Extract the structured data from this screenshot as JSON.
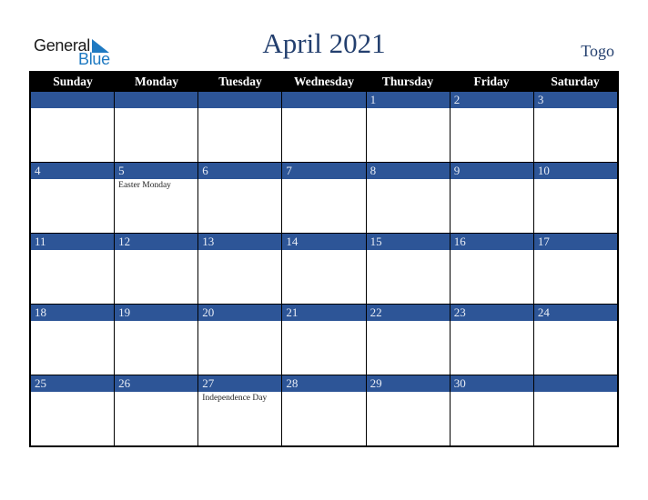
{
  "logo": {
    "line1": "General",
    "line2": "Blue",
    "icon": "triangle-flag-icon",
    "color": "#1f7ac2"
  },
  "title": "April 2021",
  "country": "Togo",
  "colors": {
    "header_bg": "#000000",
    "date_bar": "#2d5597",
    "title": "#233f6e"
  },
  "weekdays": [
    "Sunday",
    "Monday",
    "Tuesday",
    "Wednesday",
    "Thursday",
    "Friday",
    "Saturday"
  ],
  "weeks": [
    [
      {
        "date": "",
        "holiday": ""
      },
      {
        "date": "",
        "holiday": ""
      },
      {
        "date": "",
        "holiday": ""
      },
      {
        "date": "",
        "holiday": ""
      },
      {
        "date": "1",
        "holiday": ""
      },
      {
        "date": "2",
        "holiday": ""
      },
      {
        "date": "3",
        "holiday": ""
      }
    ],
    [
      {
        "date": "4",
        "holiday": ""
      },
      {
        "date": "5",
        "holiday": "Easter Monday"
      },
      {
        "date": "6",
        "holiday": ""
      },
      {
        "date": "7",
        "holiday": ""
      },
      {
        "date": "8",
        "holiday": ""
      },
      {
        "date": "9",
        "holiday": ""
      },
      {
        "date": "10",
        "holiday": ""
      }
    ],
    [
      {
        "date": "11",
        "holiday": ""
      },
      {
        "date": "12",
        "holiday": ""
      },
      {
        "date": "13",
        "holiday": ""
      },
      {
        "date": "14",
        "holiday": ""
      },
      {
        "date": "15",
        "holiday": ""
      },
      {
        "date": "16",
        "holiday": ""
      },
      {
        "date": "17",
        "holiday": ""
      }
    ],
    [
      {
        "date": "18",
        "holiday": ""
      },
      {
        "date": "19",
        "holiday": ""
      },
      {
        "date": "20",
        "holiday": ""
      },
      {
        "date": "21",
        "holiday": ""
      },
      {
        "date": "22",
        "holiday": ""
      },
      {
        "date": "23",
        "holiday": ""
      },
      {
        "date": "24",
        "holiday": ""
      }
    ],
    [
      {
        "date": "25",
        "holiday": ""
      },
      {
        "date": "26",
        "holiday": ""
      },
      {
        "date": "27",
        "holiday": "Independence Day"
      },
      {
        "date": "28",
        "holiday": ""
      },
      {
        "date": "29",
        "holiday": ""
      },
      {
        "date": "30",
        "holiday": ""
      },
      {
        "date": "",
        "holiday": ""
      }
    ]
  ]
}
